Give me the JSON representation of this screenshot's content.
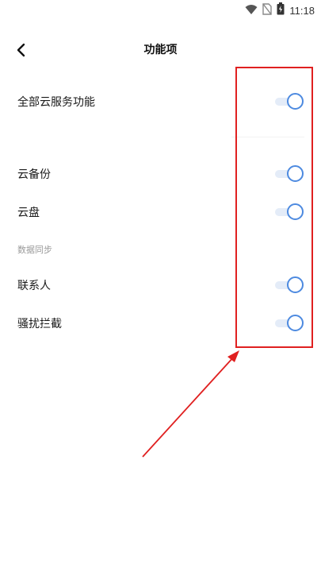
{
  "status_bar": {
    "time": "11:18",
    "icons": [
      "wifi-icon",
      "no-sim-icon",
      "battery-icon"
    ]
  },
  "header": {
    "title": "功能项",
    "back_icon": "chevron-left-icon"
  },
  "settings": {
    "all_cloud": {
      "label": "全部云服务功能",
      "enabled": true
    },
    "cloud_backup": {
      "label": "云备份",
      "enabled": true
    },
    "cloud_drive": {
      "label": "云盘",
      "enabled": true
    },
    "data_sync_section": "数据同步",
    "contacts": {
      "label": "联系人",
      "enabled": true
    },
    "harass_block": {
      "label": "骚扰拦截",
      "enabled": true
    }
  },
  "colors": {
    "toggle_accent": "#4d8ae0",
    "toggle_track": "#e4ecf8",
    "annotation": "#e02020"
  }
}
